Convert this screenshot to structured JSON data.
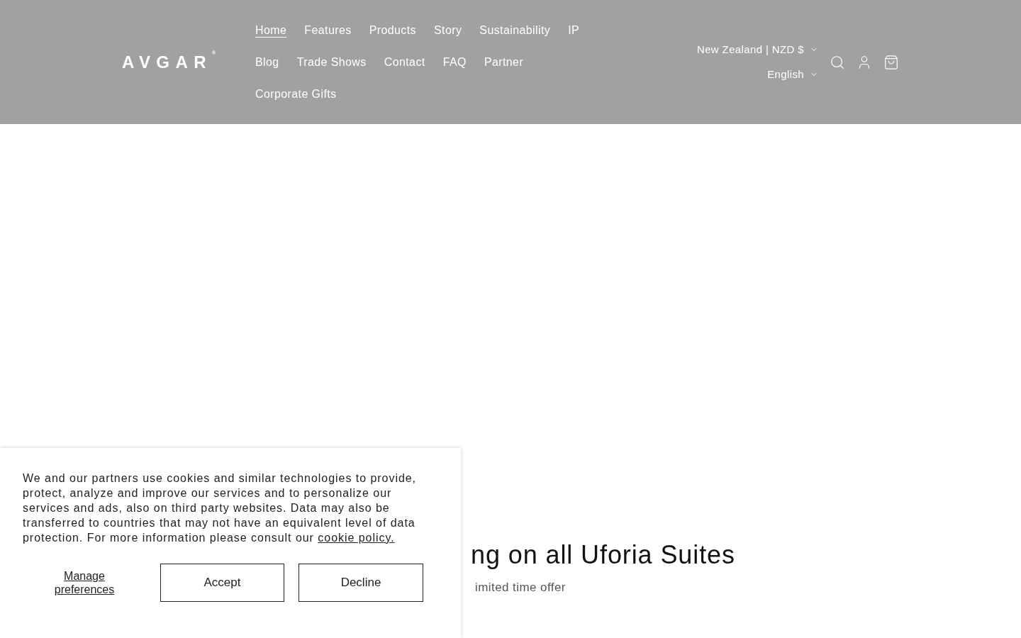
{
  "header": {
    "logo": {
      "text": "AVGAR",
      "mark": "®"
    },
    "nav": [
      {
        "label": "Home",
        "selected": true
      },
      {
        "label": "Features",
        "selected": false
      },
      {
        "label": "Products",
        "selected": false
      },
      {
        "label": "Story",
        "selected": false
      },
      {
        "label": "Sustainability",
        "selected": false
      },
      {
        "label": "IP",
        "selected": false
      },
      {
        "label": "Blog",
        "selected": false
      },
      {
        "label": "Trade Shows",
        "selected": false
      },
      {
        "label": "Contact",
        "selected": false
      },
      {
        "label": "FAQ",
        "selected": false
      },
      {
        "label": "Partner",
        "selected": false
      },
      {
        "label": "Corporate Gifts",
        "selected": false
      }
    ],
    "country": "New Zealand | NZD $",
    "language": "English"
  },
  "hero": {
    "heading": "ng on all Uforia Suites",
    "subheading": "imited time offer"
  },
  "cookie_banner": {
    "text": "We and our partners use cookies and similar technologies to provide, protect, analyze and improve our services and to personalize our services and ads, also on third party websites. Data may also be transferred to countries that may not have an equivalent level of data protection. For more information please consult our",
    "link": "cookie policy.",
    "manage": "Manage preferences",
    "accept": "Accept",
    "decline": "Decline"
  }
}
